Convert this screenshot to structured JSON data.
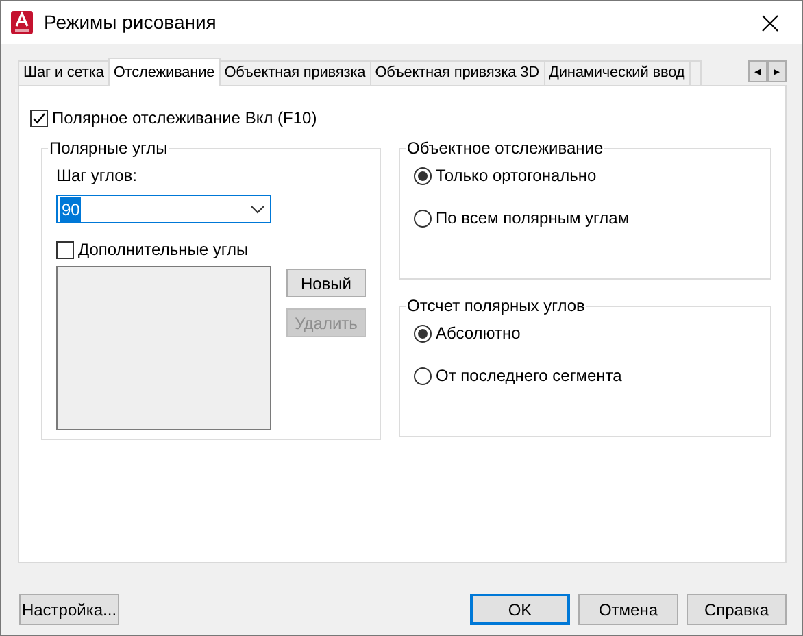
{
  "window": {
    "title": "Режимы рисования"
  },
  "tabs": [
    {
      "label": "Шаг и сетка",
      "selected": false
    },
    {
      "label": "Отслеживание",
      "selected": true
    },
    {
      "label": "Объектная привязка",
      "selected": false
    },
    {
      "label": "Объектная привязка 3D",
      "selected": false
    },
    {
      "label": "Динамический ввод",
      "selected": false
    }
  ],
  "tab_scroll": [
    "◂",
    "▸"
  ],
  "polar_tracking": {
    "label": "Полярное отслеживание Вкл (F10)",
    "checked": true
  },
  "polar_angles": {
    "title": "Полярные углы",
    "increment_label": "Шаг углов:",
    "increment_value": "90",
    "value_highlighted": true,
    "additional_angles": {
      "label": "Дополнительные углы",
      "checked": false
    },
    "buttons": [
      {
        "label": "Новый",
        "disabled": false
      },
      {
        "label": "Удалить",
        "disabled": true
      }
    ]
  },
  "object_snap_tracking": {
    "title": "Объектное отслеживание",
    "options": [
      {
        "label": "Только ортогонально",
        "selected": true
      },
      {
        "label": "По всем полярным углам",
        "selected": false
      }
    ]
  },
  "polar_angle_measurement": {
    "title": "Отсчет полярных углов",
    "options": [
      {
        "label": "Абсолютно",
        "selected": true
      },
      {
        "label": "От последнего сегмента",
        "selected": false
      }
    ]
  },
  "buttons": [
    {
      "label": "Настройка...",
      "default": false
    },
    {
      "label": "OK",
      "default": true
    },
    {
      "label": "Отмена",
      "default": false
    },
    {
      "label": "Справка",
      "default": false
    }
  ]
}
